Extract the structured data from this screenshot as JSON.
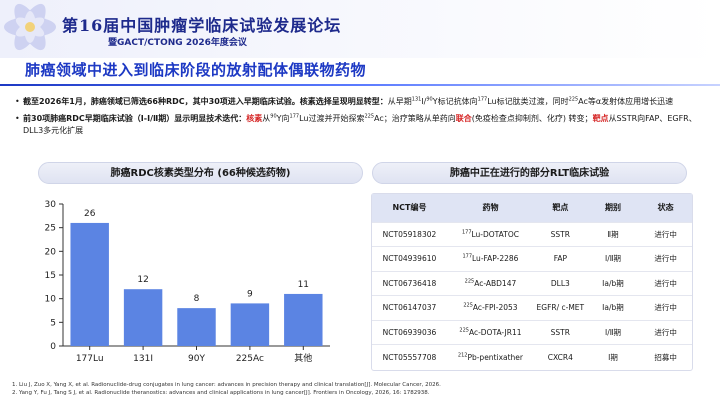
{
  "header": {
    "conference_title": "第16届中国肿瘤学临床试验发展论坛",
    "conference_subtitle": "暨GACT/CTONG 2026年度会议"
  },
  "page_title": "肺癌领域中进入到临床阶段的放射配体偶联物药物",
  "bullets": {
    "b1_bold": "截至2026年1月，肺癌领域已筛选66种RDC，其中30项进入早期临床试验。核素选择呈现明显转型：",
    "b1_pre": "从早期",
    "b1_sup1": "131",
    "b1_mid1": "I/",
    "b1_sup2": "90",
    "b1_mid2": "Y标记抗体向",
    "b1_sup3": "177",
    "b1_mid3": "Lu标记肽类过渡，同时",
    "b1_sup4": "225",
    "b1_post": "Ac等α发射体应用增长迅速",
    "b2_bold": "前30项肺癌RDC早期临床试验（Ⅰ-Ⅰ/Ⅱ期）显示明显技术迭代：",
    "b2_red1": "核素",
    "b2_t1": "从",
    "b2_sup1": "90",
    "b2_t2": "Y向",
    "b2_sup2": "177",
    "b2_t3": "Lu过渡并开始探索",
    "b2_sup3": "225",
    "b2_t4": "Ac；治疗策略从单药向",
    "b2_red2": "联合",
    "b2_t5": "(免疫检查点抑制剂、化疗) 转变；",
    "b2_red3": "靶点",
    "b2_t6": "从SSTR向FAP、EGFR、DLL3多元化扩展"
  },
  "chart_section_title": "肺癌RDC核素类型分布 (66种候选药物)",
  "table_section_title": "肺癌中正在进行的部分RLT临床试验",
  "chart_data": {
    "type": "bar",
    "categories": [
      "177Lu",
      "131I",
      "90Y",
      "225Ac",
      "其他"
    ],
    "values": [
      26,
      12,
      8,
      9,
      11
    ],
    "ylim": [
      0,
      30
    ],
    "yticks": [
      0,
      5,
      10,
      15,
      20,
      25,
      30
    ],
    "bar_color": "#5b84e3",
    "grid": false
  },
  "table": {
    "headers": [
      "NCT编号",
      "药物",
      "靶点",
      "期别",
      "状态"
    ],
    "rows": [
      {
        "nct": "NCT05918302",
        "sup": "177",
        "drug": "Lu-DOTATOC",
        "target": "SSTR",
        "phase": "Ⅱ期",
        "status": "进行中"
      },
      {
        "nct": "NCT04939610",
        "sup": "177",
        "drug": "Lu-FAP-2286",
        "target": "FAP",
        "phase": "Ⅰ/Ⅱ期",
        "status": "进行中"
      },
      {
        "nct": "NCT06736418",
        "sup": "225",
        "drug": "Ac-ABD147",
        "target": "DLL3",
        "phase": "Ⅰa/b期",
        "status": "进行中"
      },
      {
        "nct": "NCT06147037",
        "sup": "225",
        "drug": "Ac-FPI-2053",
        "target": "EGFR/ c-MET",
        "phase": "Ⅰa/b期",
        "status": "进行中"
      },
      {
        "nct": "NCT06939036",
        "sup": "225",
        "drug": "Ac-DOTA-JR11",
        "target": "SSTR",
        "phase": "Ⅰ/Ⅱ期",
        "status": "进行中"
      },
      {
        "nct": "NCT05557708",
        "sup": "212",
        "drug": "Pb-pentixather",
        "target": "CXCR4",
        "phase": "Ⅰ期",
        "status": "招募中"
      }
    ]
  },
  "footnotes": [
    "1.  Liu J, Zuo X, Yang X, et al. Radionuclide-drug conjugates in lung cancer: advances in precision therapy and clinical translation[J]. Molecular Cancer, 2026.",
    "2.  Yang Y, Fu J, Tang S J, et al. Radionuclide theranostics: advances and clinical applications in lung cancer[J]. Frontiers in Oncology, 2026, 16: 1782938."
  ]
}
